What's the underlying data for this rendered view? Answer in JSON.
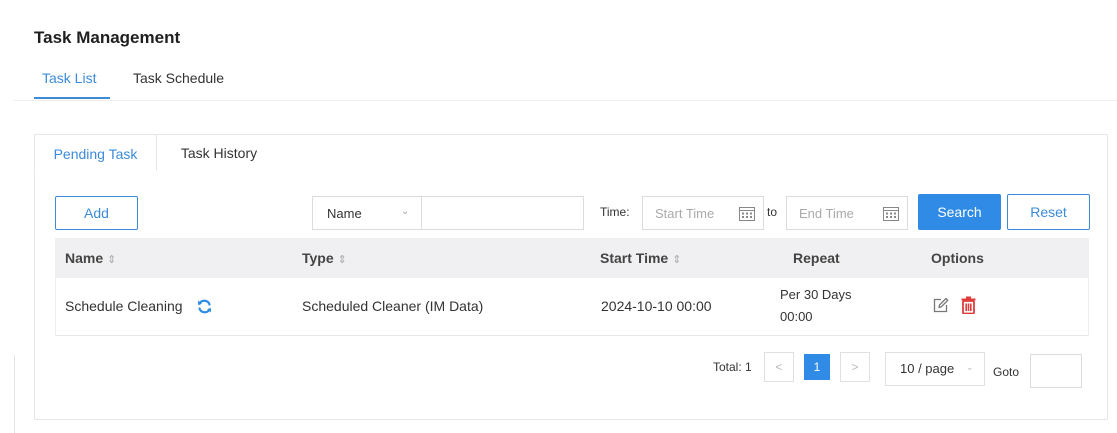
{
  "page": {
    "title": "Task Management"
  },
  "top_tabs": [
    {
      "label": "Task List",
      "active": true
    },
    {
      "label": "Task Schedule",
      "active": false
    }
  ],
  "sub_tabs": [
    {
      "label": "Pending Task",
      "active": true
    },
    {
      "label": "Task History",
      "active": false
    }
  ],
  "toolbar": {
    "add_label": "Add",
    "filter_select_value": "Name",
    "search_value": "",
    "time_label": "Time:",
    "start_placeholder": "Start Time",
    "to_label": "to",
    "end_placeholder": "End Time",
    "search_label": "Search",
    "reset_label": "Reset"
  },
  "table": {
    "columns": [
      {
        "label": "Name",
        "sortable": true
      },
      {
        "label": "Type",
        "sortable": true
      },
      {
        "label": "Start Time",
        "sortable": true
      },
      {
        "label": "Repeat",
        "sortable": false
      },
      {
        "label": "Options",
        "sortable": false
      }
    ],
    "rows": [
      {
        "name": "Schedule Cleaning",
        "type": "Scheduled Cleaner (IM Data)",
        "start_time": "2024-10-10 00:00",
        "repeat_line1": "Per 30 Days",
        "repeat_line2": "00:00",
        "icons": [
          "refresh-icon",
          "edit-icon",
          "delete-icon"
        ]
      }
    ]
  },
  "pager": {
    "total_label": "Total: 1",
    "prev": "<",
    "current_page": "1",
    "next": ">",
    "per_page": "10 / page",
    "goto_label": "Goto",
    "goto_value": ""
  },
  "colors": {
    "accent": "#3c8bd9",
    "primary_button": "#2f8be6",
    "delete": "#e03c3c",
    "header_bg": "#f0f0f2"
  }
}
